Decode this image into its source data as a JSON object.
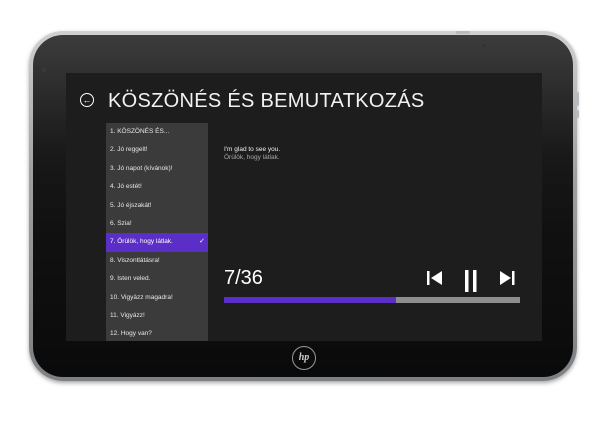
{
  "header": {
    "title": "KÖSZÖNÉS ÉS BEMUTATKOZÁS",
    "back_icon": "back-arrow-icon"
  },
  "lessons": [
    {
      "label": "1. KÖSZÖNÉS ÉS..."
    },
    {
      "label": "2. Jó reggelt!"
    },
    {
      "label": "3. Jó napot (kívánok)!"
    },
    {
      "label": "4. Jó estét!"
    },
    {
      "label": "5. Jó éjszakát!"
    },
    {
      "label": "6. Szia!"
    },
    {
      "label": "7. Örülök, hogy látlak.",
      "selected": true
    },
    {
      "label": "8. Viszontlátásra!"
    },
    {
      "label": "9. Isten veled."
    },
    {
      "label": "10. Vigyázz magadra!"
    },
    {
      "label": "11. Vigyázz!"
    },
    {
      "label": "12. Hogy van?"
    }
  ],
  "phrase": {
    "english": "I'm glad to see you.",
    "hungarian": "Örülök, hogy látlak."
  },
  "player": {
    "counter": "7/36",
    "progress_fraction": 0.58,
    "controls": [
      "previous-icon",
      "pause-icon",
      "next-icon"
    ]
  },
  "device": {
    "brand": "hp"
  },
  "colors": {
    "accent": "#5b2fc7",
    "screen_bg": "#1d1d1d",
    "list_bg": "#3b3b3b"
  }
}
